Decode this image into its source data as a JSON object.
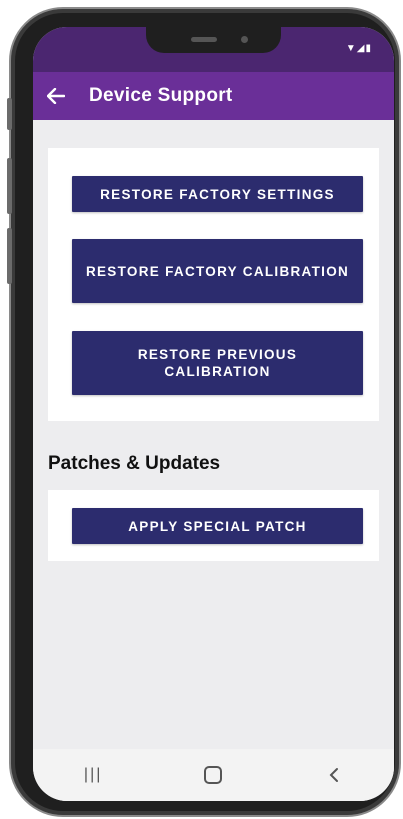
{
  "app": {
    "title": "Device Support"
  },
  "buttons": {
    "restore_factory_settings": "RESTORE FACTORY SETTINGS",
    "restore_factory_calibration": "RESTORE FACTORY CALIBRATION",
    "restore_previous_calibration": "RESTORE PREVIOUS CALIBRATION",
    "apply_special_patch": "APPLY SPECIAL PATCH"
  },
  "sections": {
    "patches_title": "Patches & Updates"
  },
  "icons": {
    "back": "back-arrow-icon",
    "status": [
      "wifi-icon",
      "signal-icon",
      "battery-icon"
    ],
    "nav": [
      "recents-icon",
      "home-icon",
      "back-icon"
    ]
  },
  "colors": {
    "status_bar": "#4b2670",
    "app_bar": "#6a2f98",
    "button": "#2c2c6e",
    "background": "#ededef"
  }
}
